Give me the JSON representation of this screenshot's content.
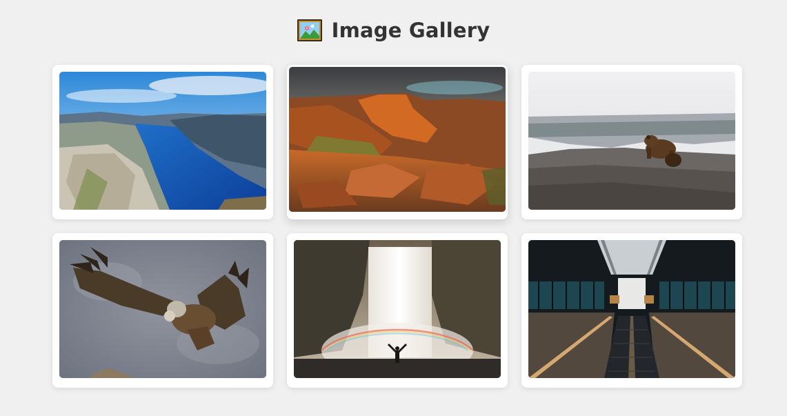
{
  "header": {
    "title": "Image Gallery",
    "icon": "framed-picture-icon"
  },
  "gallery": {
    "items": [
      {
        "subject": "fjord-landscape",
        "icon": "fjord-photo"
      },
      {
        "subject": "canyon-cliffs",
        "icon": "canyon-photo"
      },
      {
        "subject": "bear-on-rocks",
        "icon": "bear-photo"
      },
      {
        "subject": "vulture-flying",
        "icon": "vulture-photo"
      },
      {
        "subject": "waterfall-rainbow",
        "icon": "waterfall-photo"
      },
      {
        "subject": "station-escalator",
        "icon": "escalator-photo"
      }
    ]
  },
  "colors": {
    "background": "#f0f0f0",
    "card": "#ffffff",
    "title": "#333333"
  }
}
